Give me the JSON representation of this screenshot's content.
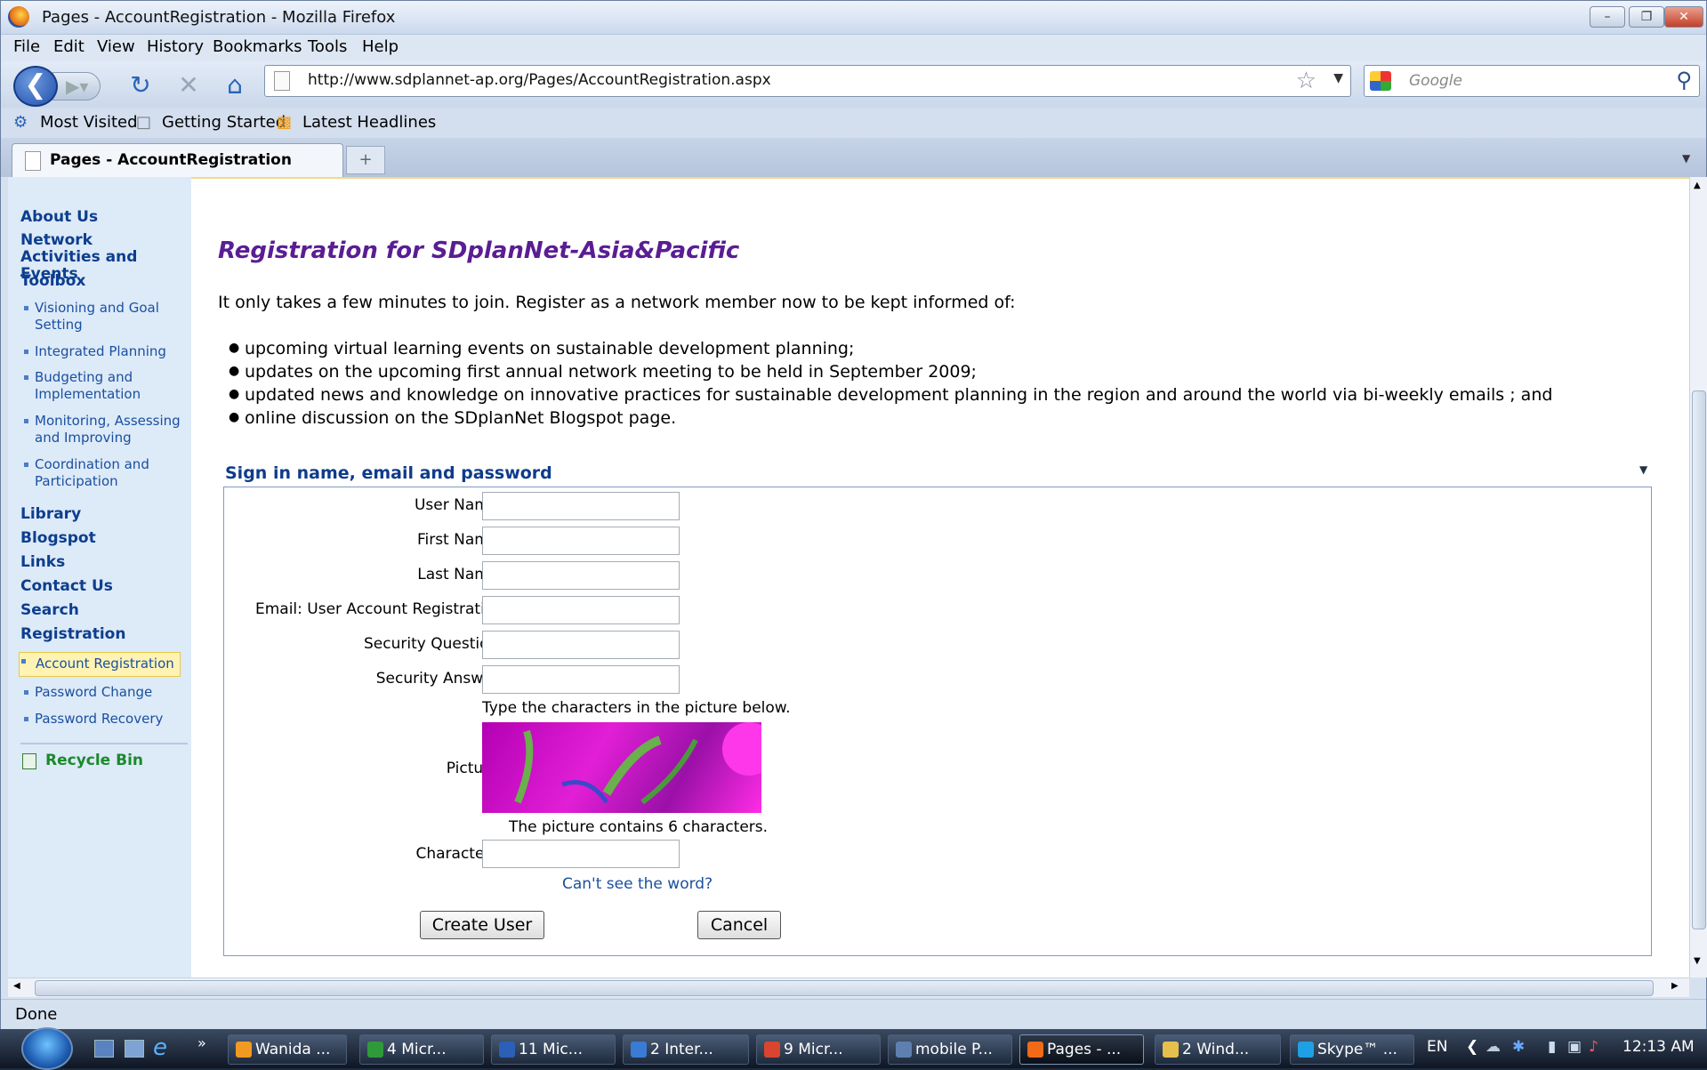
{
  "window": {
    "title": "Pages - AccountRegistration - Mozilla Firefox"
  },
  "menu": [
    "File",
    "Edit",
    "View",
    "History",
    "Bookmarks",
    "Tools",
    "Help"
  ],
  "navbar": {
    "url": "http://www.sdplannet-ap.org/Pages/AccountRegistration.aspx",
    "search_placeholder": "Google"
  },
  "bookmarks": [
    "Most Visited",
    "Getting Started",
    "Latest Headlines"
  ],
  "tab": {
    "title": "Pages - AccountRegistration"
  },
  "leftnav": {
    "about": "About Us",
    "network": "Network Activities and Events",
    "toolbox": "Toolbox",
    "toolbox_items": [
      "Visioning and Goal Setting",
      "Integrated Planning",
      "Budgeting and Implementation",
      "Monitoring, Assessing and Improving",
      "Coordination and Participation"
    ],
    "library": "Library",
    "blogspot": "Blogspot",
    "links": "Links",
    "contact": "Contact Us",
    "search": "Search",
    "registration": "Registration",
    "registration_items": [
      "Account Registration",
      "Password Change",
      "Password Recovery"
    ],
    "recycle": "Recycle Bin"
  },
  "main": {
    "title": "Registration for SDplanNet-Asia&Pacific",
    "intro": "It only takes a few minutes to join. Register as a network member now to be kept informed of:",
    "bullets": [
      "upcoming virtual learning events on sustainable development planning;",
      "updates on the upcoming first annual network meeting to be held in September 2009;",
      "updated news and knowledge on innovative practices for sustainable development planning in the region and around the world via bi-weekly emails ; and",
      "online discussion on the SDplanNet Blogspot page."
    ],
    "section": "Sign in name, email and password",
    "labels": {
      "username": "User Name:",
      "firstname": "First Name:",
      "lastname": "Last Name:",
      "email": "Email: User Account Registration",
      "question": "Security Question:",
      "answer": "Security Answer:",
      "picture": "Picture:",
      "characters": "Characters:"
    },
    "captcha_instruction": "Type the characters in the picture below.",
    "captcha_note": "The picture contains 6 characters.",
    "cant_see": "Can't see the word?",
    "create_button": "Create User",
    "cancel_button": "Cancel"
  },
  "status": "Done",
  "taskbar": {
    "items": [
      "Wanida ...",
      "4 Micr...",
      "11 Mic...",
      "2 Inter...",
      "9 Micr...",
      "mobile P...",
      "Pages - ...",
      "2 Wind...",
      "Skype™ ..."
    ],
    "lang": "EN",
    "clock": "12:13 AM"
  },
  "colors": {
    "title": "#5a1d93",
    "nav": "#0d3e8e",
    "recycle": "#1a8a2a"
  }
}
